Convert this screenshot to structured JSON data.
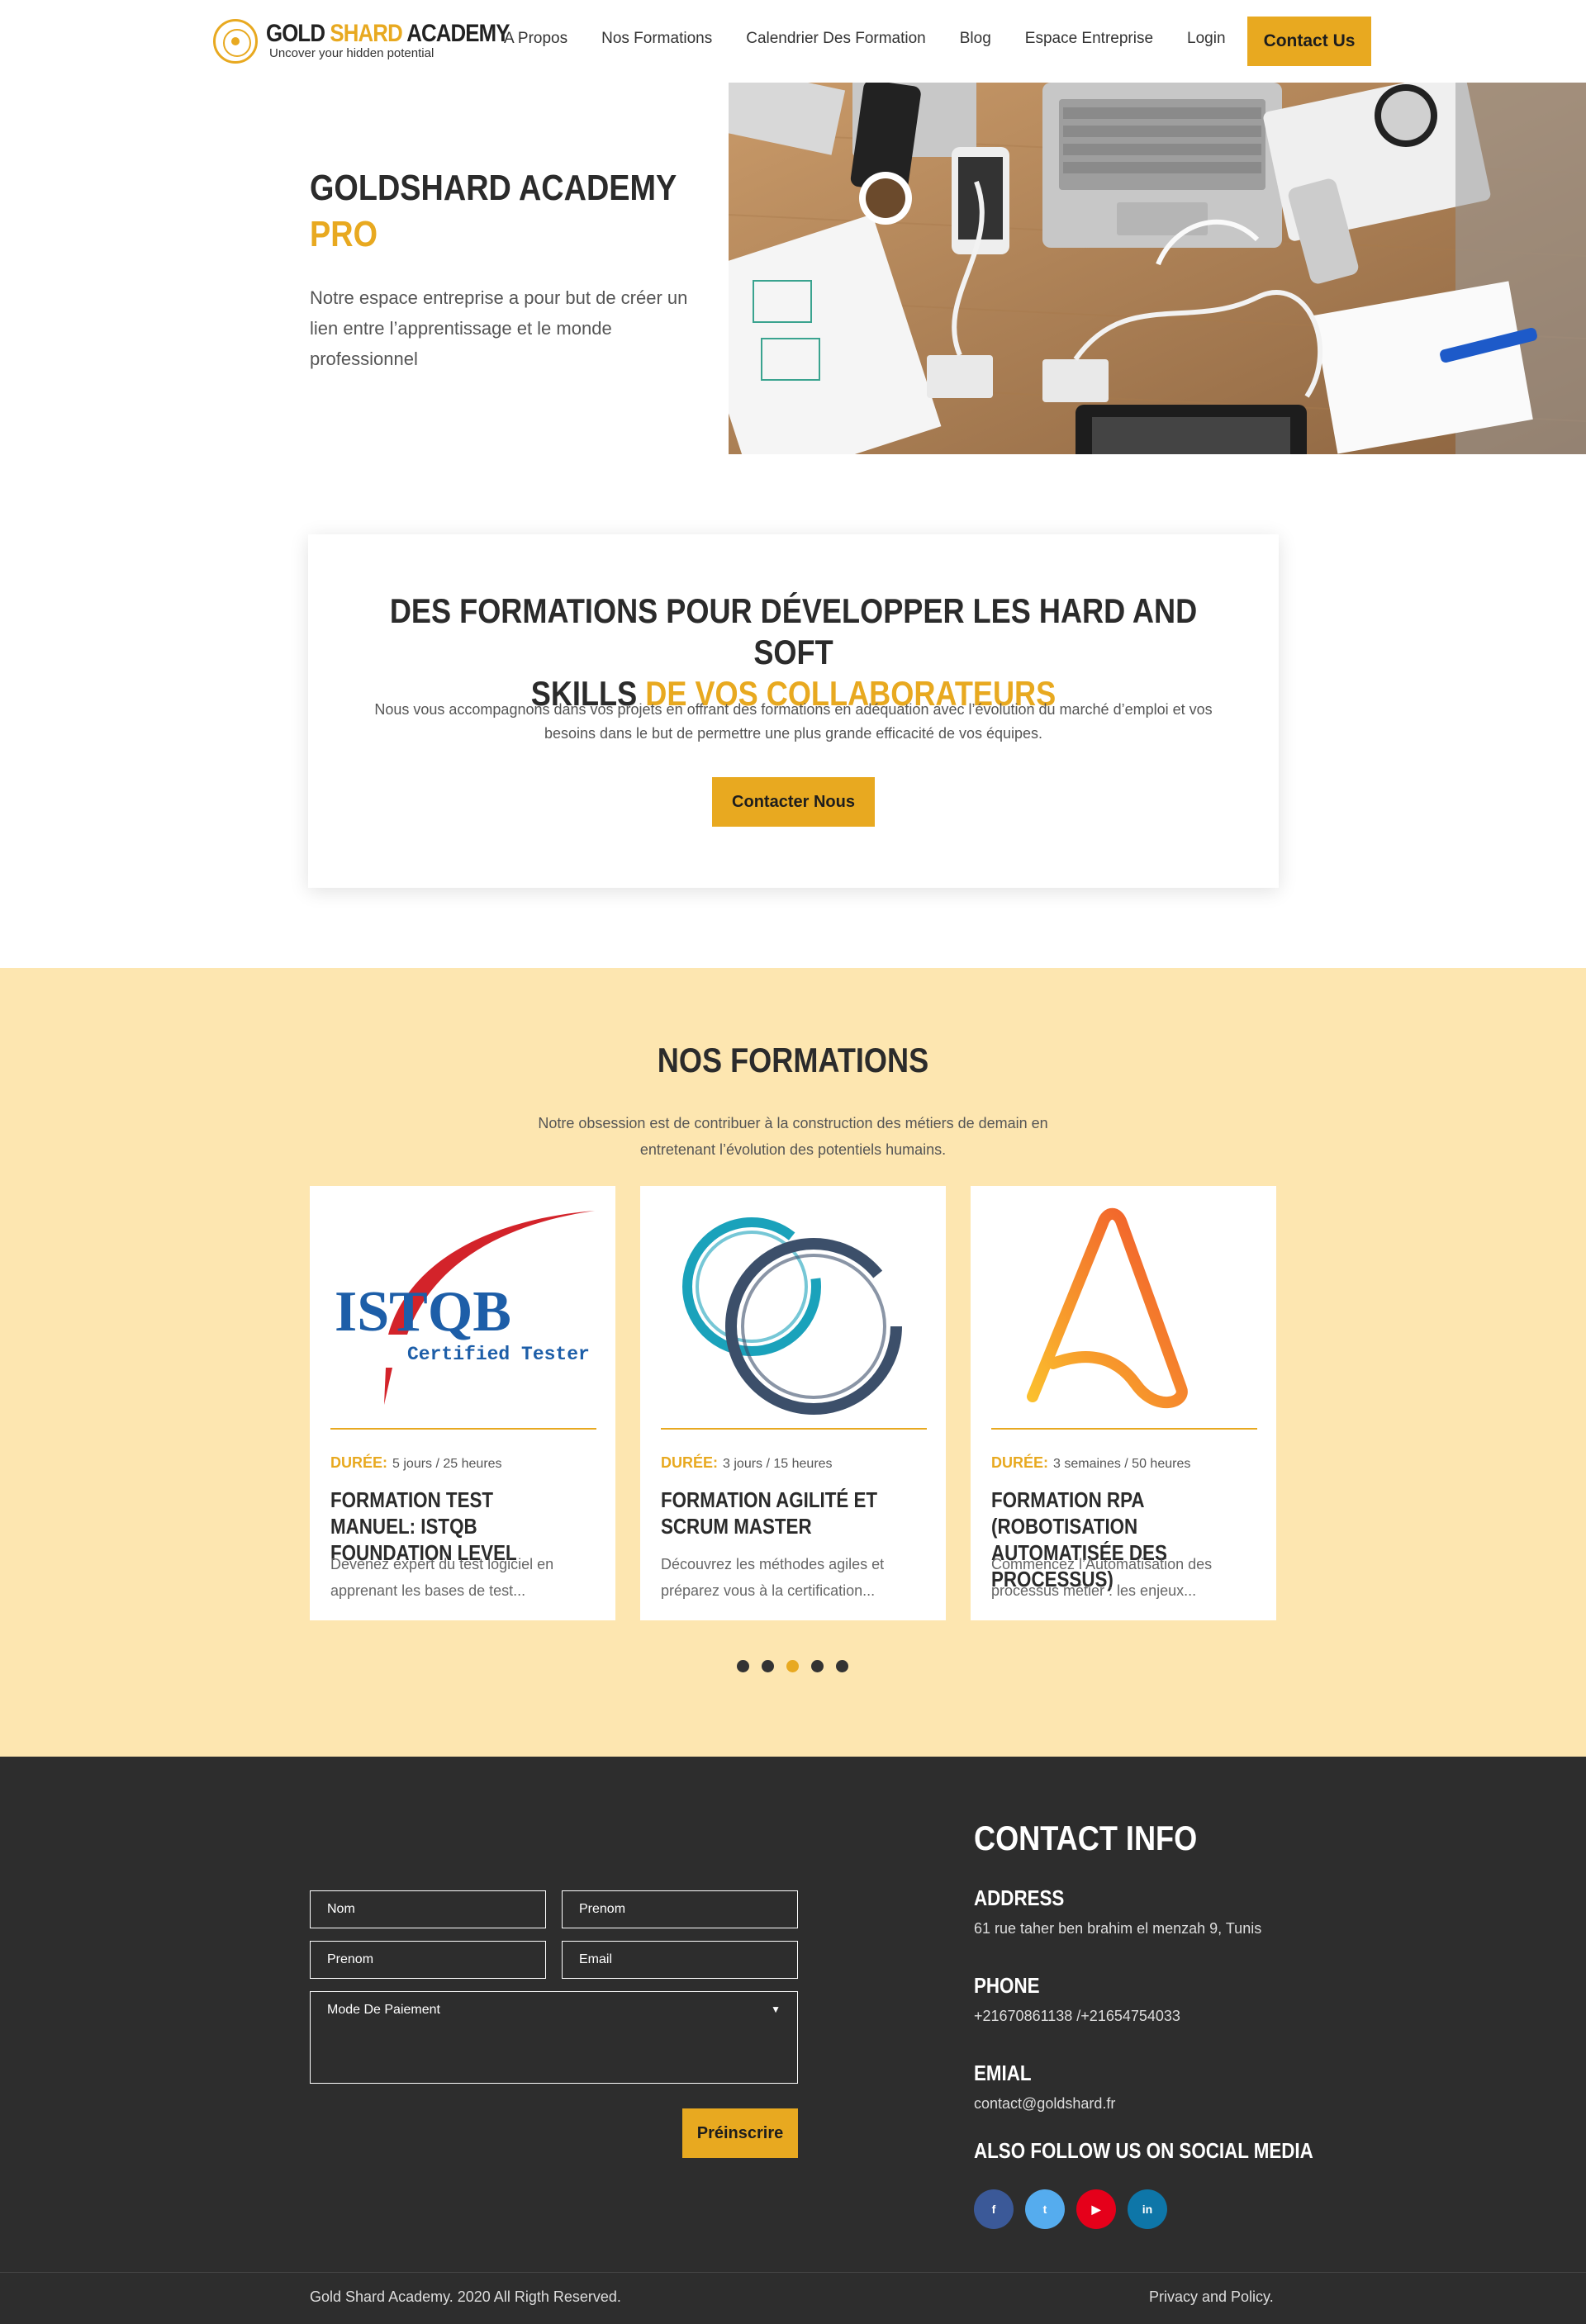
{
  "header": {
    "logo_name_part1": "GOLD",
    "logo_name_part2": "SHARD",
    "logo_name_part3": "ACADEMY",
    "logo_tagline": "Uncover your hidden potential",
    "nav": [
      "A Propos",
      "Nos Formations",
      "Calendrier Des Formation",
      "Blog",
      "Espace Entreprise",
      "Login"
    ],
    "contact_label": "Contact Us"
  },
  "hero": {
    "title": "GOLDSHARD ACADEMY",
    "title_accent": "PRO",
    "description": "Notre espace entreprise a pour but de créer un lien entre l’apprentissage et le monde professionnel"
  },
  "intro": {
    "title_line1": "DES FORMATIONS POUR DÉVELOPPER LES HARD AND SOFT",
    "title_line2_dark": "SKILLS",
    "title_line2_accent": "DE VOS COLLABORATEURS",
    "description": "Nous vous accompagnons dans vos projets en offrant des formations en adéquation avec l’évolution du marché d’emploi et vos besoins dans le but de permettre une plus grande efficacité de vos équipes.",
    "button": "Contacter Nous"
  },
  "formations": {
    "title": "NOS FORMATIONS",
    "description": "Notre obsession est de contribuer à la construction des métiers de demain en entretenant l’évolution des potentiels humains.",
    "duration_label": "DURÉE:",
    "cards": [
      {
        "logo": "istqb-logo",
        "logo_text": "ISTQB",
        "logo_sub": "Certified Tester",
        "duration": "5 jours / 25 heures",
        "title": "FORMATION TEST MANUEL: ISTQB FOUNDATION LEVEL",
        "desc": "Devenez expert du test logiciel en apprenant les bases de test..."
      },
      {
        "logo": "scrum-rings-logo",
        "duration": "3 jours / 15 heures",
        "title": "FORMATION AGILITÉ ET SCRUM MASTER",
        "desc": "Découvrez les méthodes agiles et préparez vous à la certification..."
      },
      {
        "logo": "automation-anywhere-logo",
        "duration": "3 semaines / 50 heures",
        "title": "FORMATION RPA (ROBOTISATION AUTOMATISÉE DES PROCESSUS)",
        "desc": "Commencez l’Automatisation des processus métier : les enjeux..."
      }
    ],
    "slides_total": 5,
    "active_slide": 3
  },
  "footer": {
    "fields": {
      "nom": "Nom",
      "prenom1": "Prenom",
      "prenom2": "Prenom",
      "email": "Email",
      "paiement": "Mode De Paiement"
    },
    "submit": "Préinscrire",
    "contact_title": "CONTACT INFO",
    "address_label": "ADDRESS",
    "address": "61 rue taher ben brahim el menzah 9, Tunis",
    "phone_label": "PHONE",
    "phone": "+21670861138 /+21654754033",
    "email_label": "EMIAL",
    "email": "contact@goldshard.fr",
    "social_title": "ALSO FOLLOW US ON SOCIAL MEDIA",
    "social": [
      {
        "icon": "facebook-icon",
        "glyph": "f",
        "color": "#3b5998"
      },
      {
        "icon": "twitter-icon",
        "glyph": "t",
        "color": "#55acee"
      },
      {
        "icon": "youtube-icon",
        "glyph": "▶",
        "color": "#e5001a"
      },
      {
        "icon": "linkedin-icon",
        "glyph": "in",
        "color": "#0e76a8"
      }
    ],
    "copyright": "Gold Shard Academy. 2020 All Rigth Reserved.",
    "privacy": "Privacy and Policy."
  },
  "colors": {
    "accent": "#e8a920",
    "section_bg": "#fde6b0",
    "footer_bg": "#2d2d2d"
  }
}
